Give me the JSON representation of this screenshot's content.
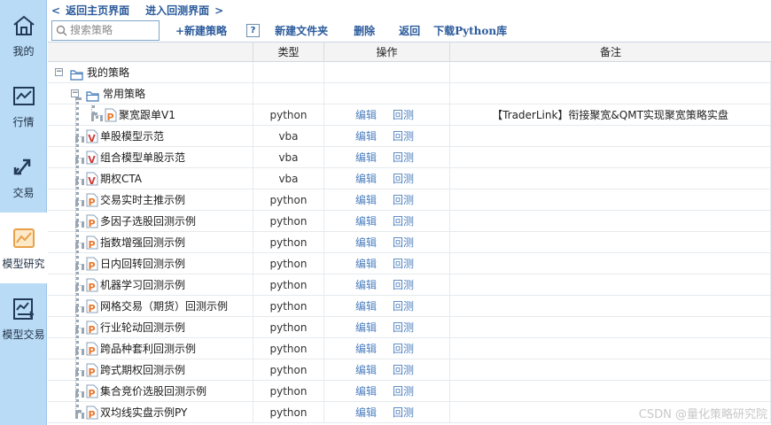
{
  "sidebar": {
    "items": [
      {
        "label": "我的",
        "icon": "home-icon"
      },
      {
        "label": "行情",
        "icon": "chart-line-icon"
      },
      {
        "label": "交易",
        "icon": "trade-arrows-icon"
      },
      {
        "label": "模型研究",
        "icon": "model-research-icon"
      },
      {
        "label": "模型交易",
        "icon": "model-trade-icon"
      }
    ],
    "active": "模型研究"
  },
  "topnav": {
    "back_home": "返回主页界面",
    "enter_backtest": "进入回测界面"
  },
  "toolbar": {
    "search_placeholder": "搜索策略",
    "new_strategy": "+新建策略",
    "help": "?",
    "new_folder": "新建文件夹",
    "delete": "删除",
    "back": "返回",
    "download_python": "下载Python库"
  },
  "table": {
    "headers": {
      "name": "",
      "type": "类型",
      "ops": "操作",
      "note": "备注"
    },
    "op_edit": "编辑",
    "op_backtest": "回测",
    "folders": [
      {
        "label": "我的策略",
        "expanded": true
      },
      {
        "label": "常用策略",
        "expanded": true
      }
    ],
    "rows": [
      {
        "name": "聚宽跟单V1",
        "type": "python",
        "badge": "P",
        "level": 2,
        "note": "【TraderLink】衔接聚宽&QMT实现聚宽策略实盘"
      },
      {
        "name": "单股模型示范",
        "type": "vba",
        "badge": "V",
        "level": 1,
        "note": ""
      },
      {
        "name": "组合模型单股示范",
        "type": "vba",
        "badge": "V",
        "level": 1,
        "note": ""
      },
      {
        "name": "期权CTA",
        "type": "vba",
        "badge": "V",
        "level": 1,
        "note": ""
      },
      {
        "name": "交易实时主推示例",
        "type": "python",
        "badge": "P",
        "level": 1,
        "note": ""
      },
      {
        "name": "多因子选股回测示例",
        "type": "python",
        "badge": "P",
        "level": 1,
        "note": ""
      },
      {
        "name": "指数增强回测示例",
        "type": "python",
        "badge": "P",
        "level": 1,
        "note": ""
      },
      {
        "name": "日内回转回测示例",
        "type": "python",
        "badge": "P",
        "level": 1,
        "note": ""
      },
      {
        "name": "机器学习回测示例",
        "type": "python",
        "badge": "P",
        "level": 1,
        "note": ""
      },
      {
        "name": "网格交易（期货）回测示例",
        "type": "python",
        "badge": "P",
        "level": 1,
        "note": ""
      },
      {
        "name": "行业轮动回测示例",
        "type": "python",
        "badge": "P",
        "level": 1,
        "note": ""
      },
      {
        "name": "跨品种套利回测示例",
        "type": "python",
        "badge": "P",
        "level": 1,
        "note": ""
      },
      {
        "name": "跨式期权回测示例",
        "type": "python",
        "badge": "P",
        "level": 1,
        "note": ""
      },
      {
        "name": "集合竞价选股回测示例",
        "type": "python",
        "badge": "P",
        "level": 1,
        "note": ""
      },
      {
        "name": "双均线实盘示例PY",
        "type": "python",
        "badge": "P",
        "level": 1,
        "note": ""
      }
    ]
  },
  "watermark": "CSDN @量化策略研究院",
  "colors": {
    "sidebar_bg": "#b9dbf5",
    "link_blue": "#2a5a9b",
    "op_blue": "#4c7fbf",
    "python_badge": "#e8762c",
    "vba_badge": "#d13b3b"
  }
}
